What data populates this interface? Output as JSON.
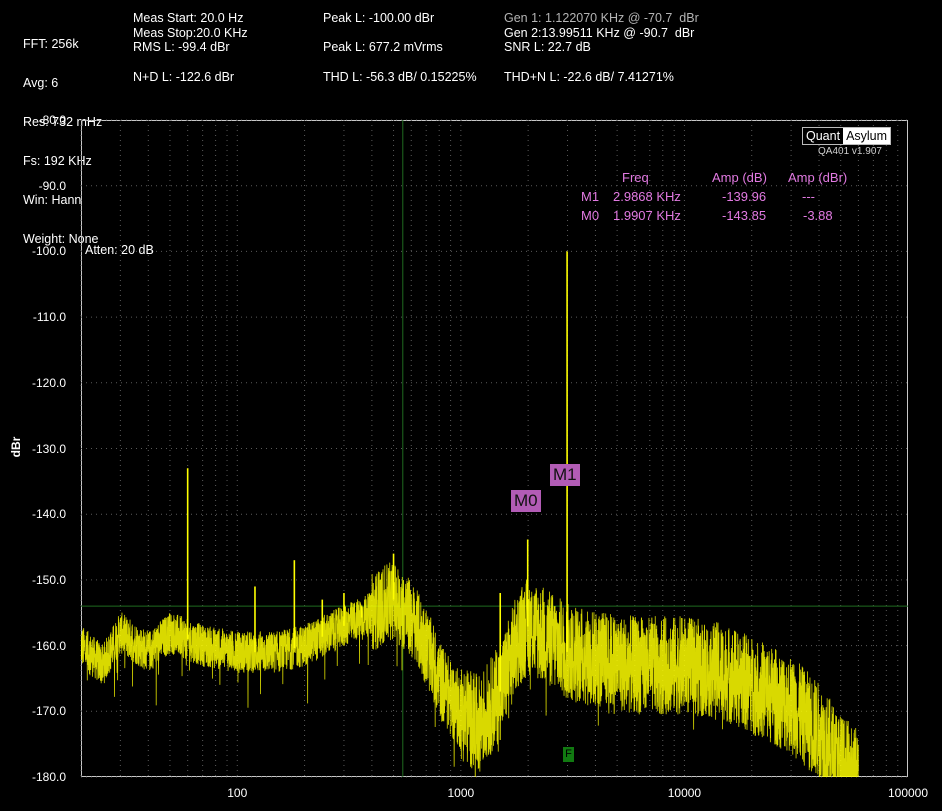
{
  "header": {
    "col1": [
      "FFT: 256k",
      "Avg: 6",
      "Res: 732 mHz",
      "Fs: 192 KHz",
      "Win: Hann",
      "Weight: None"
    ],
    "meas_start": "Meas Start: 20.0 Hz",
    "meas_stop": "Meas Stop:20.0 KHz",
    "rms_l": "RMS L: -99.4 dBr",
    "nd_l": "N+D L: -122.6 dBr",
    "peak_l_dbr": "Peak L: -100.00 dBr",
    "peak_l_vrms": "Peak L: 677.2 mVrms",
    "thd_l": "THD L: -56.3 dB/ 0.15225%",
    "gen1": "Gen 1: 1.122070 KHz @ -70.7  dBr",
    "gen2": "Gen 2:13.99511 KHz @ -90.7  dBr",
    "snr_l": "SNR L: 22.7 dB",
    "thdn_l": "THD+N L: -22.6 dB/ 7.41271%"
  },
  "logo": {
    "part1": "Quant",
    "part2": "Asylum",
    "version": "QA401 v1.907"
  },
  "attenuation": "Atten: 20 dB",
  "marker_table": {
    "headers": [
      "Freq",
      "Amp (dB)",
      "Amp (dBr)"
    ],
    "rows": [
      {
        "name": "M1",
        "freq": "2.9868 KHz",
        "amp_db": "-139.96",
        "amp_dbr": "---"
      },
      {
        "name": "M0",
        "freq": "1.9907 KHz",
        "amp_db": "-143.85",
        "amp_dbr": "-3.88"
      }
    ]
  },
  "marker_labels": {
    "m0": "M0",
    "m1": "M1",
    "f": "F"
  },
  "colors": {
    "trace": "#ffff00",
    "marker": "#b25cb5",
    "marker_text": "#e27ae2",
    "cursor": "#1f6b1f",
    "grid": "#5a5a5a"
  },
  "chart_data": {
    "type": "line",
    "xscale": "log",
    "xlim": [
      20,
      100000
    ],
    "ylim": [
      -180,
      -80
    ],
    "ylabel": "dBr",
    "xticks": [
      100,
      1000,
      10000,
      100000
    ],
    "xtick_labels": [
      "100",
      "1000",
      "10000",
      "100000"
    ],
    "yticks": [
      -80,
      -90,
      -100,
      -110,
      -120,
      -130,
      -140,
      -150,
      -160,
      -170,
      -180
    ],
    "ytick_labels": [
      "-80.0",
      "-90.0",
      "-100.0",
      "-110.0",
      "-120.0",
      "-130.0",
      "-140.0",
      "-150.0",
      "-160.0",
      "-170.0",
      "-180.0"
    ],
    "grid": true,
    "cursor": {
      "freq": 550,
      "level": -154
    },
    "noise_floor": [
      [
        20,
        -160
      ],
      [
        25,
        -163
      ],
      [
        30,
        -158
      ],
      [
        40,
        -161
      ],
      [
        50,
        -158
      ],
      [
        70,
        -160
      ],
      [
        100,
        -161
      ],
      [
        150,
        -161
      ],
      [
        200,
        -160
      ],
      [
        300,
        -157
      ],
      [
        400,
        -155
      ],
      [
        500,
        -153
      ],
      [
        600,
        -156
      ],
      [
        700,
        -160
      ],
      [
        800,
        -165
      ],
      [
        900,
        -168
      ],
      [
        1000,
        -170
      ],
      [
        1200,
        -172
      ],
      [
        1500,
        -167
      ],
      [
        1800,
        -159
      ],
      [
        2000,
        -157
      ],
      [
        2500,
        -159
      ],
      [
        3000,
        -161
      ],
      [
        4000,
        -162
      ],
      [
        6000,
        -163
      ],
      [
        10000,
        -163
      ],
      [
        15000,
        -164
      ],
      [
        20000,
        -166
      ],
      [
        30000,
        -169
      ],
      [
        40000,
        -173
      ],
      [
        50000,
        -178
      ],
      [
        60000,
        -180
      ]
    ],
    "spurs": [
      {
        "freq": 60,
        "level": -133
      },
      {
        "freq": 120,
        "level": -151
      },
      {
        "freq": 180,
        "level": -147
      },
      {
        "freq": 240,
        "level": -153
      },
      {
        "freq": 300,
        "level": -152
      },
      {
        "freq": 360,
        "level": -154
      },
      {
        "freq": 500,
        "level": -146
      },
      {
        "freq": 1500,
        "level": -152
      },
      {
        "freq": 1990.7,
        "level": -143.85
      },
      {
        "freq": 2986.8,
        "level": -100.0
      }
    ],
    "markers": [
      {
        "name": "M1",
        "freq": 2986.8,
        "level": -139.96
      },
      {
        "name": "M0",
        "freq": 1990.7,
        "level": -143.85
      }
    ]
  }
}
